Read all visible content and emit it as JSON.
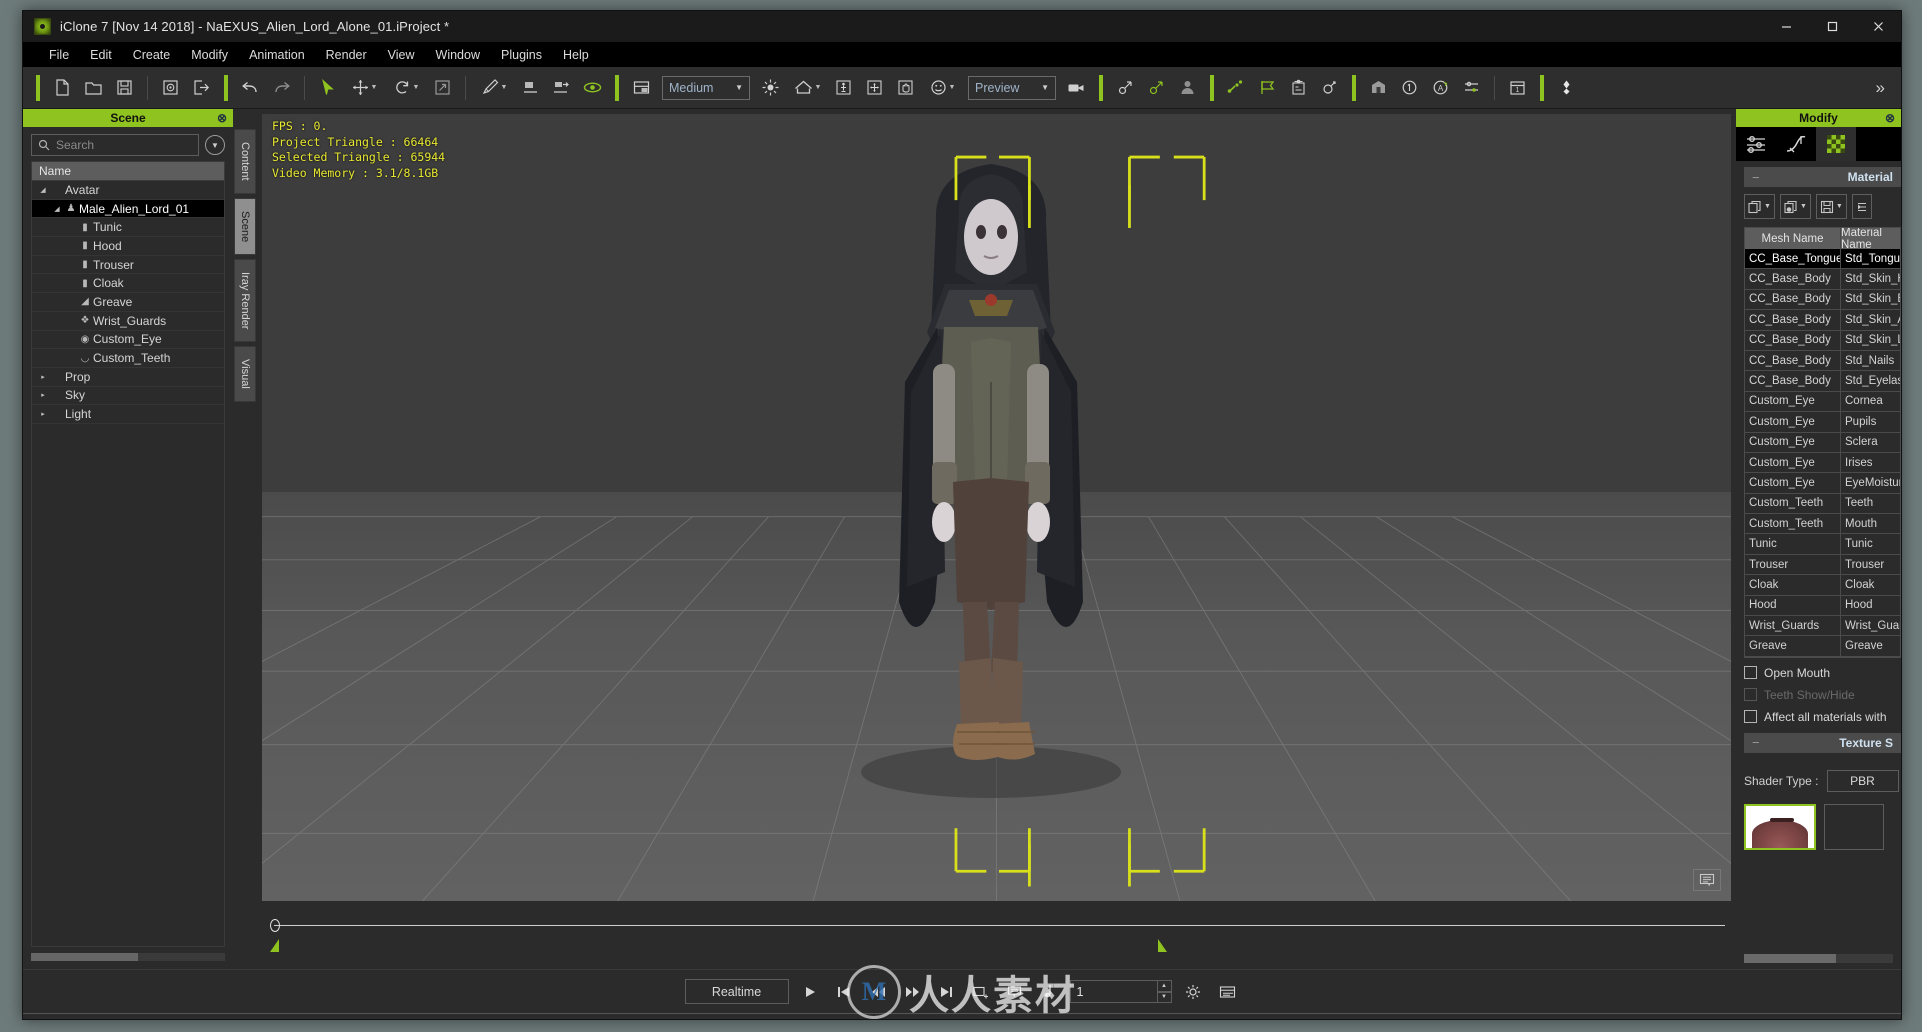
{
  "window": {
    "title": "iClone 7 [Nov 14 2018] - NaEXUS_Alien_Lord_Alone_01.iProject *",
    "app_icon": "iclone-logo-icon",
    "minimize": "–",
    "maximize": "☐",
    "close": "✕"
  },
  "menubar": {
    "items": [
      "File",
      "Edit",
      "Create",
      "Modify",
      "Animation",
      "Render",
      "View",
      "Window",
      "Plugins",
      "Help"
    ]
  },
  "toolbar": {
    "quality_combo": "Medium",
    "render_combo": "Preview",
    "overflow": "»",
    "buttons": [
      {
        "name": "new-project-icon",
        "title": "New"
      },
      {
        "name": "open-project-icon",
        "title": "Open"
      },
      {
        "name": "save-project-icon",
        "title": "Save"
      },
      {
        "name": "import-icon",
        "title": "Import"
      },
      {
        "name": "export-icon",
        "title": "Export"
      },
      {
        "name": "undo-icon",
        "title": "Undo"
      },
      {
        "name": "redo-icon",
        "title": "Redo"
      },
      {
        "name": "select-tool-icon",
        "title": "Select"
      },
      {
        "name": "move-tool-icon",
        "title": "Move"
      },
      {
        "name": "rotate-tool-icon",
        "title": "Rotate"
      },
      {
        "name": "scale-tool-icon",
        "title": "Scale"
      },
      {
        "name": "edit-mesh-icon",
        "title": "Edit Mesh"
      },
      {
        "name": "align-bottom-icon",
        "title": "Align"
      },
      {
        "name": "align-export-icon",
        "title": "Align Export"
      },
      {
        "name": "preview-eye-icon",
        "title": "Preview Toggle"
      },
      {
        "name": "viewport-layout-icon",
        "title": "Viewport Layout"
      },
      {
        "name": "light-icon",
        "title": "Light"
      },
      {
        "name": "home-icon",
        "title": "Home"
      },
      {
        "name": "person-height-icon",
        "title": "Character Height"
      },
      {
        "name": "transform-move-icon",
        "title": "Transform"
      },
      {
        "name": "hand-pose-icon",
        "title": "Hand Pose"
      },
      {
        "name": "face-puppet-icon",
        "title": "Face Puppet"
      },
      {
        "name": "camera-icon",
        "title": "Camera"
      },
      {
        "name": "motion-path-icon",
        "title": "Motion Path"
      },
      {
        "name": "motion-path-add-icon",
        "title": "Add Motion Path"
      },
      {
        "name": "avatar-icon",
        "title": "Avatar"
      },
      {
        "name": "motion-puppet-icon",
        "title": "Motion Puppet"
      },
      {
        "name": "flag-icon",
        "title": "Flag"
      },
      {
        "name": "keyframe-panel-icon",
        "title": "Keyframe"
      },
      {
        "name": "spring-icon",
        "title": "Spring"
      },
      {
        "name": "stage-icon",
        "title": "Stage"
      },
      {
        "name": "info-circle-icon",
        "title": "Info"
      },
      {
        "name": "auto-circle-icon",
        "title": "Auto"
      },
      {
        "name": "settings-sliders-icon",
        "title": "Settings"
      },
      {
        "name": "calendar-icon",
        "title": "Timeline"
      },
      {
        "name": "diamond-icon",
        "title": "Key"
      }
    ]
  },
  "scene_panel": {
    "title": "Scene",
    "close_icon": "⊗",
    "search_placeholder": "Search",
    "search_icon": "search-icon",
    "filter_icon": "chevron-down-icon",
    "column_header": "Name",
    "tree": [
      {
        "label": "Avatar",
        "depth": 0,
        "expander": "◢",
        "icon": "",
        "selected": false
      },
      {
        "label": "Male_Alien_Lord_01",
        "depth": 1,
        "expander": "◢",
        "icon": "person-icon",
        "selected": true
      },
      {
        "label": "Tunic",
        "depth": 2,
        "expander": "",
        "icon": "shirt-icon",
        "selected": false
      },
      {
        "label": "Hood",
        "depth": 2,
        "expander": "",
        "icon": "shirt-icon",
        "selected": false
      },
      {
        "label": "Trouser",
        "depth": 2,
        "expander": "",
        "icon": "shirt-icon",
        "selected": false
      },
      {
        "label": "Cloak",
        "depth": 2,
        "expander": "",
        "icon": "shirt-icon",
        "selected": false
      },
      {
        "label": "Greave",
        "depth": 2,
        "expander": "",
        "icon": "shoe-icon",
        "selected": false
      },
      {
        "label": "Wrist_Guards",
        "depth": 2,
        "expander": "",
        "icon": "glove-icon",
        "selected": false
      },
      {
        "label": "Custom_Eye",
        "depth": 2,
        "expander": "",
        "icon": "eye-icon",
        "selected": false
      },
      {
        "label": "Custom_Teeth",
        "depth": 2,
        "expander": "",
        "icon": "teeth-icon",
        "selected": false
      },
      {
        "label": "Prop",
        "depth": 0,
        "expander": "▸",
        "icon": "",
        "selected": false
      },
      {
        "label": "Sky",
        "depth": 0,
        "expander": "▸",
        "icon": "",
        "selected": false
      },
      {
        "label": "Light",
        "depth": 0,
        "expander": "▸",
        "icon": "",
        "selected": false
      }
    ]
  },
  "vertical_tabs": [
    {
      "label": "Content",
      "selected": false
    },
    {
      "label": "Scene",
      "selected": true
    },
    {
      "label": "Iray Render",
      "selected": false
    },
    {
      "label": "Visual",
      "selected": false
    }
  ],
  "viewport": {
    "stats": "FPS : 0.\nProject Triangle : 66464\nSelected Triangle : 65944\nVideo Memory : 3.1/8.1GB",
    "stats_lines": [
      "FPS : 0.",
      "Project Triangle : 66464",
      "Selected Triangle : 65944",
      "Video Memory : 3.1/8.1GB"
    ],
    "corner_badge_icon": "note-balloon-icon",
    "selection_color": "#d7e01a"
  },
  "modify_panel": {
    "title": "Modify",
    "close_icon": "⊗",
    "tabs": [
      {
        "name": "attribute-tab",
        "icon": "sliders-icon",
        "selected": false
      },
      {
        "name": "animation-tab",
        "icon": "curve-icon",
        "selected": false
      },
      {
        "name": "material-tab",
        "icon": "checker-icon",
        "selected": true
      }
    ],
    "material_section_label": "Material",
    "texture_section_label": "Texture S",
    "tool_buttons": [
      {
        "name": "copy-material-button",
        "icon": "copy-icon"
      },
      {
        "name": "paste-material-button",
        "icon": "paste-icon"
      },
      {
        "name": "save-material-button",
        "icon": "save-icon"
      },
      {
        "name": "load-material-button",
        "icon": "load-icon"
      }
    ],
    "table": {
      "columns": [
        "Mesh Name",
        "Material Name"
      ],
      "rows": [
        {
          "mesh": "CC_Base_Tongue",
          "material": "Std_Tongue",
          "selected": true
        },
        {
          "mesh": "CC_Base_Body",
          "material": "Std_Skin_Head",
          "selected": false
        },
        {
          "mesh": "CC_Base_Body",
          "material": "Std_Skin_Body",
          "selected": false
        },
        {
          "mesh": "CC_Base_Body",
          "material": "Std_Skin_Arm",
          "selected": false
        },
        {
          "mesh": "CC_Base_Body",
          "material": "Std_Skin_Leg",
          "selected": false
        },
        {
          "mesh": "CC_Base_Body",
          "material": "Std_Nails",
          "selected": false
        },
        {
          "mesh": "CC_Base_Body",
          "material": "Std_Eyelash",
          "selected": false
        },
        {
          "mesh": "Custom_Eye",
          "material": "Cornea",
          "selected": false
        },
        {
          "mesh": "Custom_Eye",
          "material": "Pupils",
          "selected": false
        },
        {
          "mesh": "Custom_Eye",
          "material": "Sclera",
          "selected": false
        },
        {
          "mesh": "Custom_Eye",
          "material": "Irises",
          "selected": false
        },
        {
          "mesh": "Custom_Eye",
          "material": "EyeMoisture",
          "selected": false
        },
        {
          "mesh": "Custom_Teeth",
          "material": "Teeth",
          "selected": false
        },
        {
          "mesh": "Custom_Teeth",
          "material": "Mouth",
          "selected": false
        },
        {
          "mesh": "Tunic",
          "material": "Tunic",
          "selected": false
        },
        {
          "mesh": "Trouser",
          "material": "Trouser",
          "selected": false
        },
        {
          "mesh": "Cloak",
          "material": "Cloak",
          "selected": false
        },
        {
          "mesh": "Hood",
          "material": "Hood",
          "selected": false
        },
        {
          "mesh": "Wrist_Guards",
          "material": "Wrist_Guards",
          "selected": false
        },
        {
          "mesh": "Greave",
          "material": "Greave",
          "selected": false
        }
      ]
    },
    "checkboxes": [
      {
        "label": "Open Mouth",
        "checked": false,
        "disabled": false
      },
      {
        "label": "Teeth Show/Hide",
        "checked": false,
        "disabled": true
      },
      {
        "label": "Affect all materials with",
        "checked": false,
        "disabled": false
      }
    ],
    "shader_type_label": "Shader Type :",
    "shader_type_value": "PBR"
  },
  "bottom_bar": {
    "realtime_label": "Realtime",
    "frame_value": "1",
    "transport": [
      {
        "name": "play-button",
        "icon": "▶"
      },
      {
        "name": "prev-keyframe-button",
        "icon": "prev-key-icon"
      },
      {
        "name": "rewind-button",
        "icon": "◀◀"
      },
      {
        "name": "fast-forward-button",
        "icon": "▶▶"
      },
      {
        "name": "next-keyframe-button",
        "icon": "next-key-icon"
      },
      {
        "name": "add-keyframe-button",
        "icon": "add-key-icon"
      },
      {
        "name": "comment-button",
        "icon": "comment-icon"
      },
      {
        "name": "audio-button",
        "icon": "note-icon"
      }
    ],
    "settings_icon": "gear-icon",
    "timeline_icon": "timeline-icon"
  },
  "watermark": {
    "mark": "M",
    "text": "人人素材"
  },
  "colors": {
    "accent_green": "#8fc31f",
    "panel_bg": "#2b2b2b",
    "toolbar_bg": "#2e2e2e",
    "stats_yellow": "#e8e832",
    "selection_black": "#000000"
  }
}
